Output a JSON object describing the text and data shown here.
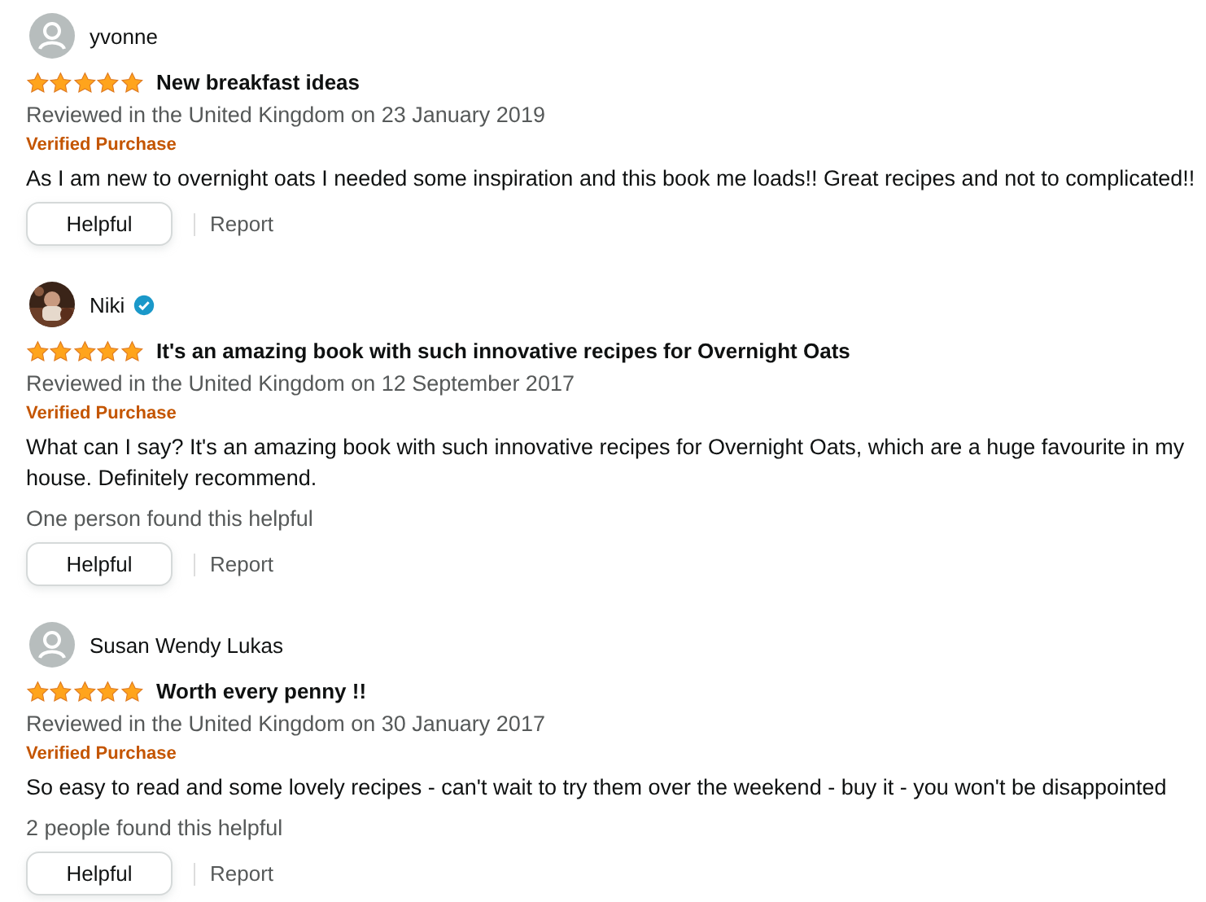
{
  "reviews": [
    {
      "author": "yvonne",
      "avatar": {
        "kind": "default"
      },
      "verified_badge": false,
      "stars": 5,
      "title": "New breakfast ideas",
      "date": "Reviewed in the United Kingdom on 23 January 2019",
      "verified_purchase": "Verified Purchase",
      "body": "As I am new to overnight oats I needed some inspiration and this book me loads!! Great recipes and not to complicated!!",
      "helpful_button": "Helpful",
      "report": "Report"
    },
    {
      "author": "Niki",
      "verified_badge": true,
      "stars": 5,
      "title": "It's an amazing book with such innovative recipes for Overnight Oats",
      "date": "Reviewed in the United Kingdom on 12 September 2017",
      "verified_purchase": "Verified Purchase",
      "body": "What can I say? It's an amazing book with such innovative recipes for Overnight Oats, which are a huge favourite in my house. Definitely recommend.",
      "helpful_count": "One person found this helpful",
      "helpful_button": "Helpful",
      "report": "Report"
    },
    {
      "author": "Susan Wendy Lukas",
      "avatar": {
        "kind": "default"
      },
      "verified_badge": false,
      "stars": 5,
      "title": "Worth every penny !!",
      "date": "Reviewed in the United Kingdom on 30 January 2017",
      "verified_purchase": "Verified Purchase",
      "body": "So easy to read and some lovely recipes - can't wait to try them over the weekend - buy it - you won't be disappointed",
      "helpful_count": "2 people found this helpful",
      "helpful_button": "Helpful",
      "report": "Report"
    }
  ]
}
